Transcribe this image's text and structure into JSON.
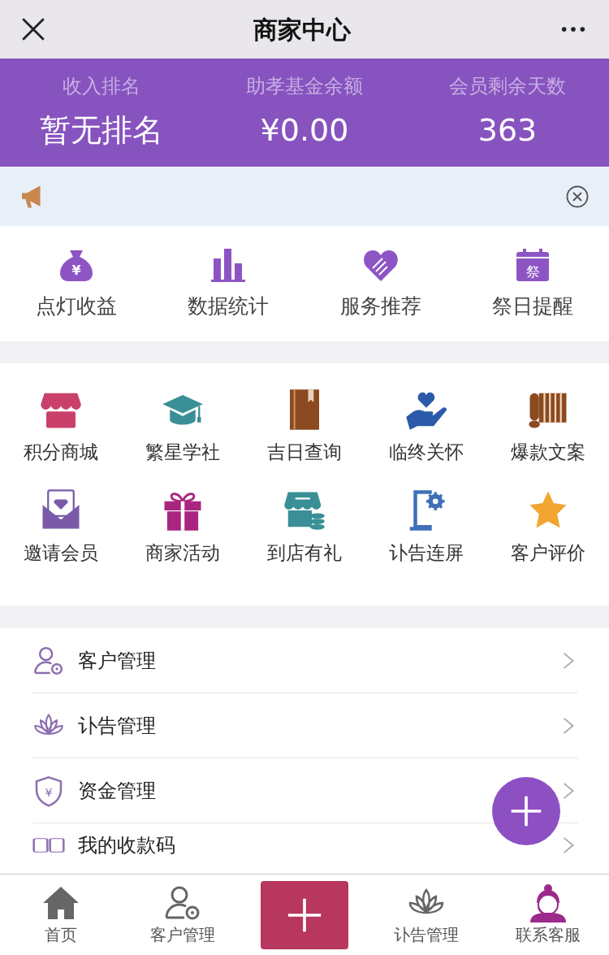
{
  "header": {
    "title": "商家中心"
  },
  "stats": [
    {
      "label": "收入排名",
      "value": "暂无排名"
    },
    {
      "label": "助孝基金余额",
      "value": "¥0.00"
    },
    {
      "label": "会员剩余天数",
      "value": "363"
    }
  ],
  "quick_menu": [
    {
      "label": "点灯收益",
      "icon_text": "¥"
    },
    {
      "label": "数据统计"
    },
    {
      "label": "服务推荐"
    },
    {
      "label": "祭日提醒",
      "icon_text": "祭"
    }
  ],
  "feature_grid": [
    {
      "label": "积分商城"
    },
    {
      "label": "繁星学社"
    },
    {
      "label": "吉日查询"
    },
    {
      "label": "临终关怀"
    },
    {
      "label": "爆款文案"
    },
    {
      "label": "邀请会员"
    },
    {
      "label": "商家活动"
    },
    {
      "label": "到店有礼"
    },
    {
      "label": "讣告连屏"
    },
    {
      "label": "客户评价"
    }
  ],
  "menu_list": [
    {
      "label": "客户管理"
    },
    {
      "label": "讣告管理"
    },
    {
      "label": "资金管理",
      "icon_text": "¥"
    },
    {
      "label": "我的收款码"
    }
  ],
  "tab_bar": [
    {
      "label": "首页"
    },
    {
      "label": "客户管理"
    },
    {
      "kind": "add"
    },
    {
      "label": "讣告管理"
    },
    {
      "label": "联系客服"
    }
  ]
}
